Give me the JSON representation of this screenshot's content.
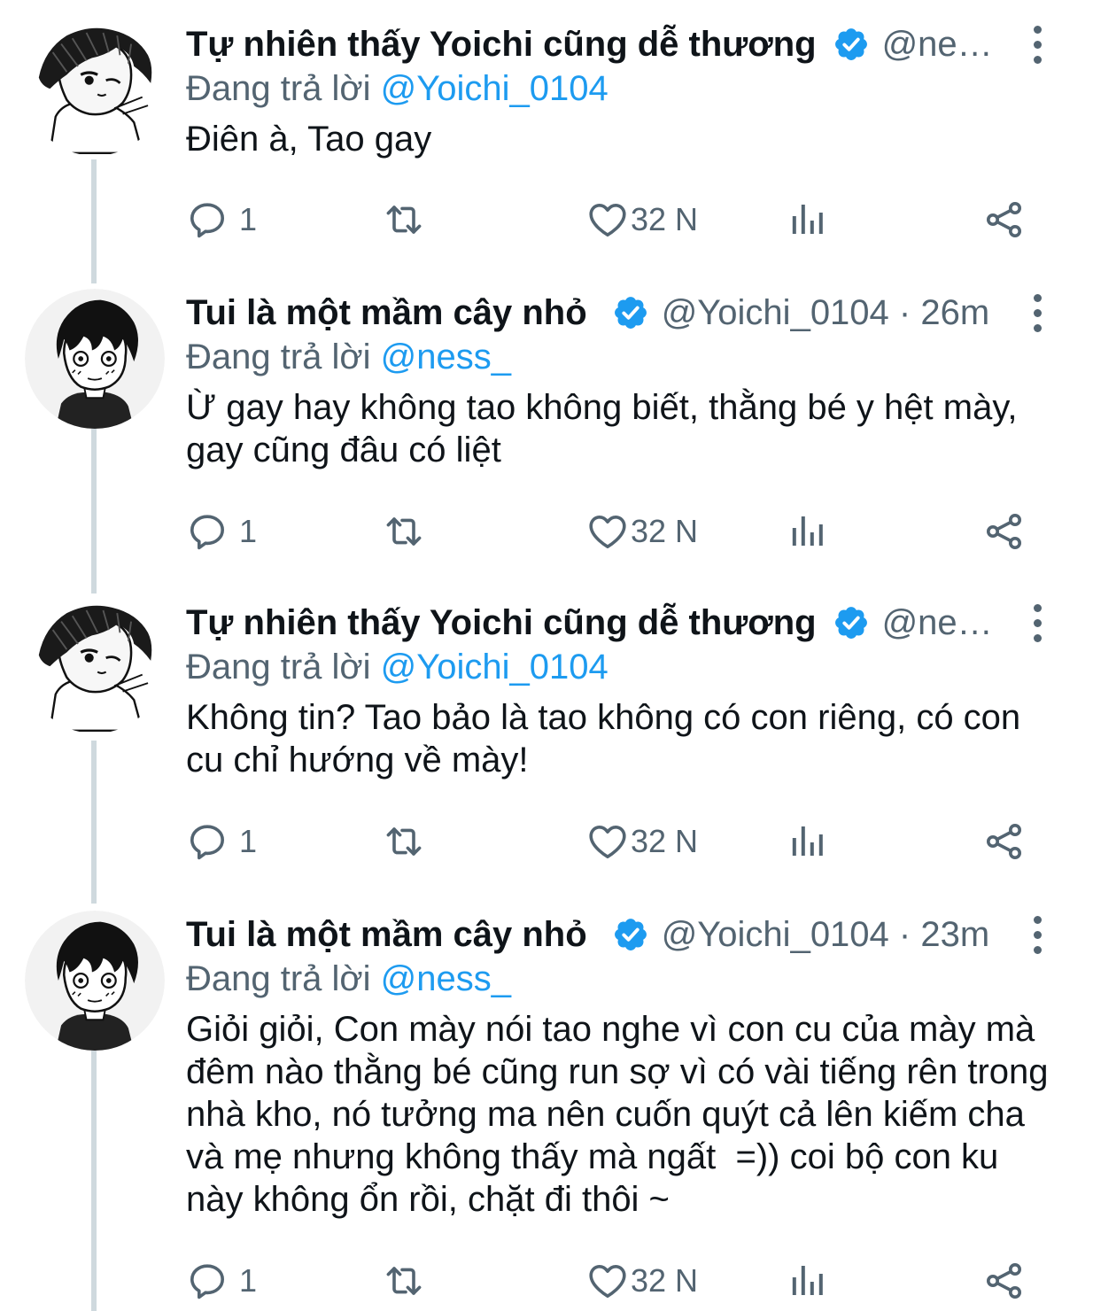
{
  "colors": {
    "accent": "#1d9bf0",
    "secondary_text": "#536471",
    "thread_line": "#cfd9de"
  },
  "reply_prefix": "Đang trả lời",
  "tweets": [
    {
      "name": "Tự nhiên thấy Yoichi cũng dễ thương",
      "handle": "@ness...",
      "reply_to": "@Yoichi_0104",
      "text": "Điên à, Tao gay",
      "replies": "1",
      "likes": "32 N"
    },
    {
      "name": "Tui là một mầm cây nhỏ",
      "handle": "@Yoichi_0104 · 26m",
      "reply_to": "@ness_",
      "text": "Ừ gay hay không tao không biết, thằng bé y hệt mày, gay cũng đâu có liệt",
      "replies": "1",
      "likes": "32 N"
    },
    {
      "name": "Tự nhiên thấy Yoichi cũng dễ thương",
      "handle": "@ness...",
      "reply_to": "@Yoichi_0104",
      "text": "Không tin? Tao bảo là tao không có con riêng, có con cu chỉ hướng về mày!",
      "replies": "1",
      "likes": "32 N"
    },
    {
      "name": "Tui là một mầm cây nhỏ",
      "handle": "@Yoichi_0104 · 23m",
      "reply_to": "@ness_",
      "text": "Giỏi giỏi, Con mày nói tao nghe vì con cu của mày mà đêm nào thằng bé cũng run sợ vì có vài tiếng rên trong nhà kho, nó tưởng ma nên cuốn quýt cả lên kiếm cha và mẹ nhưng không thấy mà ngất  =)) coi bộ con ku này không ổn rồi, chặt đi thôi ~",
      "replies": "1",
      "likes": "32 N"
    }
  ]
}
